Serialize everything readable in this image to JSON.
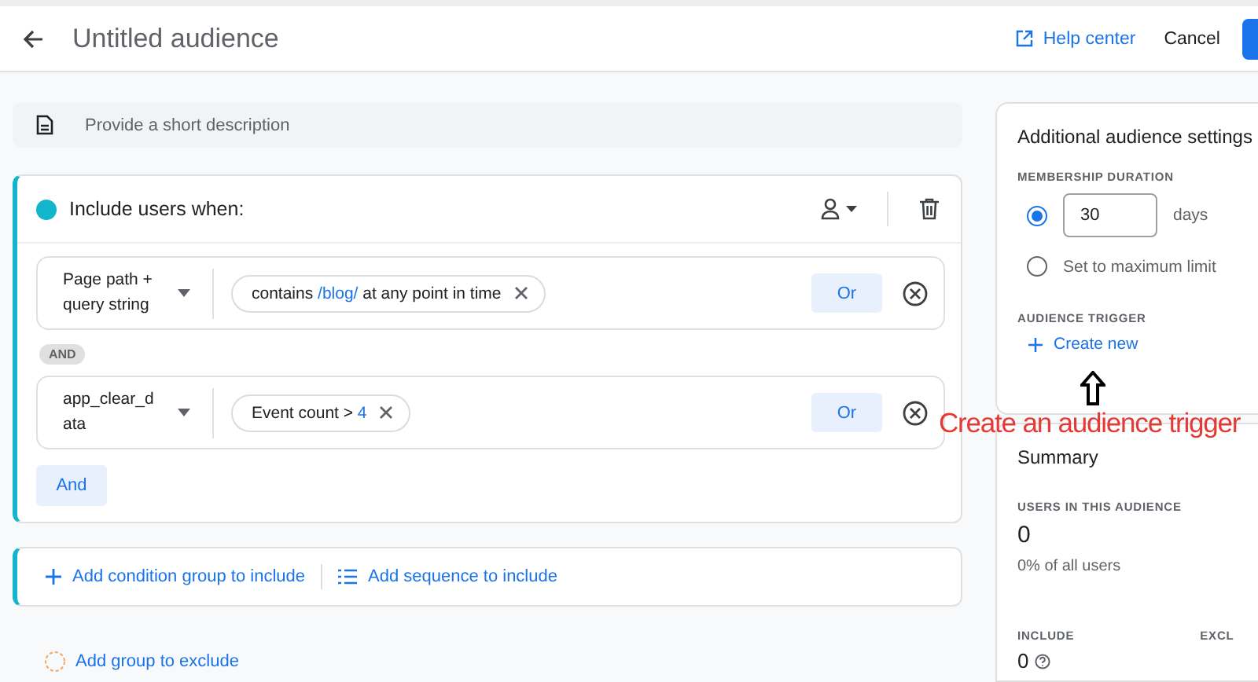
{
  "header": {
    "title": "Untitled audience",
    "help": "Help center",
    "cancel": "Cancel"
  },
  "description": {
    "placeholder": "Provide a short description"
  },
  "include_group": {
    "title": "Include users when:",
    "connector": "AND",
    "and_button": "And",
    "conditions": [
      {
        "dimension": "Page path + query string",
        "chip": [
          {
            "kind": "plain",
            "text": "contains "
          },
          {
            "kind": "value",
            "text": "/blog/"
          },
          {
            "kind": "plain",
            "text": " at any point in time"
          }
        ],
        "or_label": "Or"
      },
      {
        "dimension": "app_clear_d ata",
        "chip": [
          {
            "kind": "plain",
            "text": "Event count > "
          },
          {
            "kind": "value",
            "text": "4"
          }
        ],
        "or_label": "Or"
      }
    ]
  },
  "add_actions": [
    {
      "kind": "plus",
      "label": "Add condition group to include"
    },
    {
      "kind": "list",
      "label": "Add sequence to include"
    }
  ],
  "exclude": {
    "label": "Add group to exclude"
  },
  "settings": {
    "title": "Additional audience settings",
    "duration_label": "MEMBERSHIP DURATION",
    "options": [
      {
        "kind": "days",
        "selected": true,
        "value": "30",
        "unit": "days"
      },
      {
        "kind": "max",
        "selected": false,
        "label": "Set to maximum limit"
      }
    ],
    "trigger_label": "AUDIENCE TRIGGER",
    "create": "Create new"
  },
  "summary": {
    "title": "Summary",
    "users_label": "USERS IN THIS AUDIENCE",
    "users": "0",
    "share": "0% of all users",
    "include_label": "INCLUDE",
    "include_value": "0",
    "exclude_label": "EXCL"
  },
  "annotation": {
    "text": "Create an audience trigger"
  }
}
